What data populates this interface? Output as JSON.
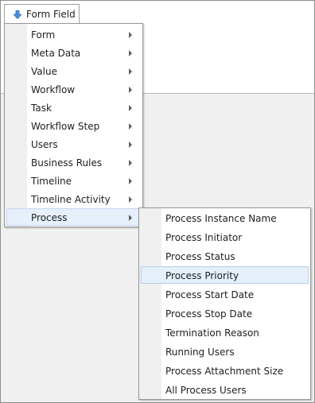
{
  "toolbar": {
    "button_label": "Form Field",
    "button_icon": "down-arrow-icon"
  },
  "main_menu": {
    "items": [
      {
        "label": "Form",
        "has_submenu": true
      },
      {
        "label": "Meta Data",
        "has_submenu": true
      },
      {
        "label": "Value",
        "has_submenu": true
      },
      {
        "label": "Workflow",
        "has_submenu": true
      },
      {
        "label": "Task",
        "has_submenu": true
      },
      {
        "label": "Workflow Step",
        "has_submenu": true
      },
      {
        "label": "Users",
        "has_submenu": true
      },
      {
        "label": "Business Rules",
        "has_submenu": true
      },
      {
        "label": "Timeline",
        "has_submenu": true
      },
      {
        "label": "Timeline Activity",
        "has_submenu": true
      },
      {
        "label": "Process",
        "has_submenu": true,
        "active": true
      }
    ]
  },
  "sub_menu": {
    "parent": "Process",
    "items": [
      {
        "label": "Process Instance Name"
      },
      {
        "label": "Process Initiator"
      },
      {
        "label": "Process Status"
      },
      {
        "label": "Process Priority",
        "hovered": true
      },
      {
        "label": "Process Start Date"
      },
      {
        "label": "Process Stop Date"
      },
      {
        "label": "Termination Reason"
      },
      {
        "label": "Running Users"
      },
      {
        "label": "Process Attachment Size"
      },
      {
        "label": "All Process Users"
      }
    ]
  },
  "colors": {
    "highlight_bg": "#e5f0fb",
    "highlight_border": "#c4d9f0",
    "icon_blue": "#4a90d9",
    "gutter": "#f0f0f0"
  }
}
